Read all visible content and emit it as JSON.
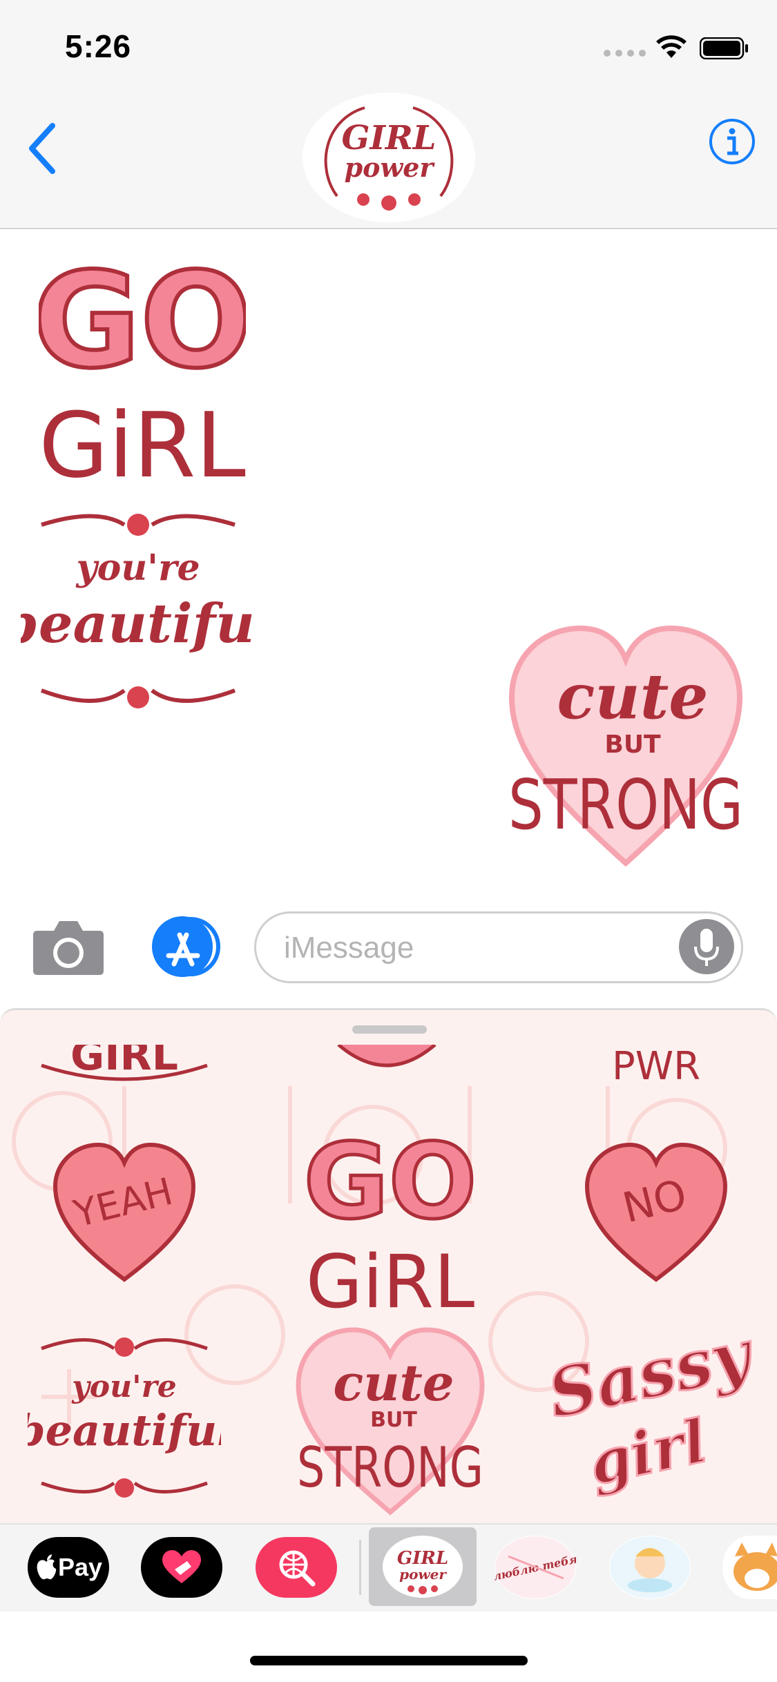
{
  "status_bar": {
    "time": "5:26"
  },
  "header": {
    "contact_logo_line1": "GIRL",
    "contact_logo_line2": "power"
  },
  "conversation": {
    "stickers": [
      {
        "line1": "GO",
        "line2": "GiRL"
      },
      {
        "line1": "you're",
        "line2": "beautiful"
      },
      {
        "line1": "cute",
        "line2": "BUT",
        "line3": "STRONG"
      }
    ]
  },
  "input_bar": {
    "placeholder": "iMessage"
  },
  "drawer": {
    "partial_top": [
      "GIRL",
      "PWR"
    ],
    "stickers": [
      {
        "text": "YEAH"
      },
      {
        "line1": "GO",
        "line2": "GiRL"
      },
      {
        "text": "NO"
      },
      {
        "line1": "you're",
        "line2": "beautiful"
      },
      {
        "line1": "cute",
        "line2": "BUT",
        "line3": "STRONG"
      },
      {
        "line1": "Sassy",
        "line2": "girl"
      }
    ]
  },
  "app_strip": {
    "applepay_label": "Pay",
    "selected_app_line1": "GIRL",
    "selected_app_line2": "power",
    "next_app_text": "люблю тебя"
  },
  "colors": {
    "accent_blue": "#147efb",
    "sticker_red": "#ad2f3a",
    "sticker_pink": "#f6a4b0",
    "drawer_bg": "#fdf1ef"
  }
}
